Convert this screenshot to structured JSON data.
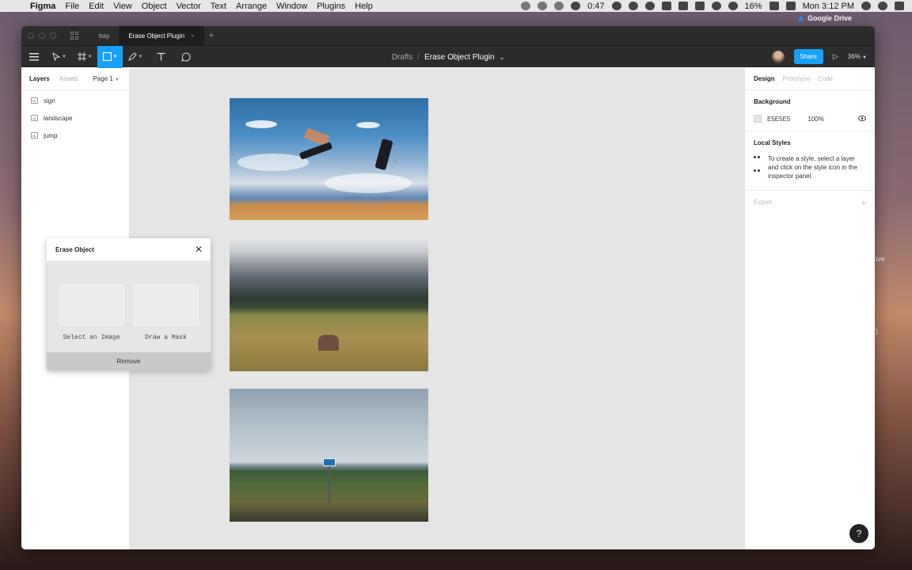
{
  "menubar": {
    "app": "Figma",
    "items": [
      "File",
      "Edit",
      "View",
      "Object",
      "Vector",
      "Text",
      "Arrange",
      "Window",
      "Plugins",
      "Help"
    ],
    "timer": "0:47",
    "battery": "16%",
    "clock": "Mon 3:12 PM"
  },
  "desktop": {
    "gdrive_label": "Google Drive",
    "partial_text_1": "ive",
    "partial_text_2": ")"
  },
  "tabs": [
    {
      "label": "tray"
    },
    {
      "label": "Erase Object Plugin",
      "close": "×"
    }
  ],
  "tab_plus": "+",
  "toolbar": {
    "breadcrumb_drafts": "Drafts",
    "breadcrumb_sep": "/",
    "file_name": "Erase Object Plugin",
    "file_caret": "⌄",
    "share_label": "Share",
    "play_icon": "▷",
    "zoom": "36%"
  },
  "layers_panel": {
    "tab_layers": "Layers",
    "tab_assets": "Assets",
    "page": "Page 1",
    "layers": [
      "sign",
      "landscape",
      "jump"
    ]
  },
  "plugin": {
    "title": "Erase Object",
    "close": "✕",
    "select_caption": "Select an Image",
    "mask_caption": "Draw a Mask",
    "remove_label": "Remove"
  },
  "design_panel": {
    "tab_design": "Design",
    "tab_prototype": "Prototype",
    "tab_code": "Code",
    "background_title": "Background",
    "bg_hex": "E5E5E5",
    "bg_opacity": "100%",
    "local_styles_title": "Local Styles",
    "local_styles_text": "To create a style, select a layer and click on the style icon in the inspector panel.",
    "export_title": "Export",
    "export_plus": "+"
  },
  "help_label": "?",
  "colors": {
    "accent": "#18a0fb",
    "toolbar_bg": "#2c2c2c",
    "canvas_bg": "#e5e5e5"
  }
}
